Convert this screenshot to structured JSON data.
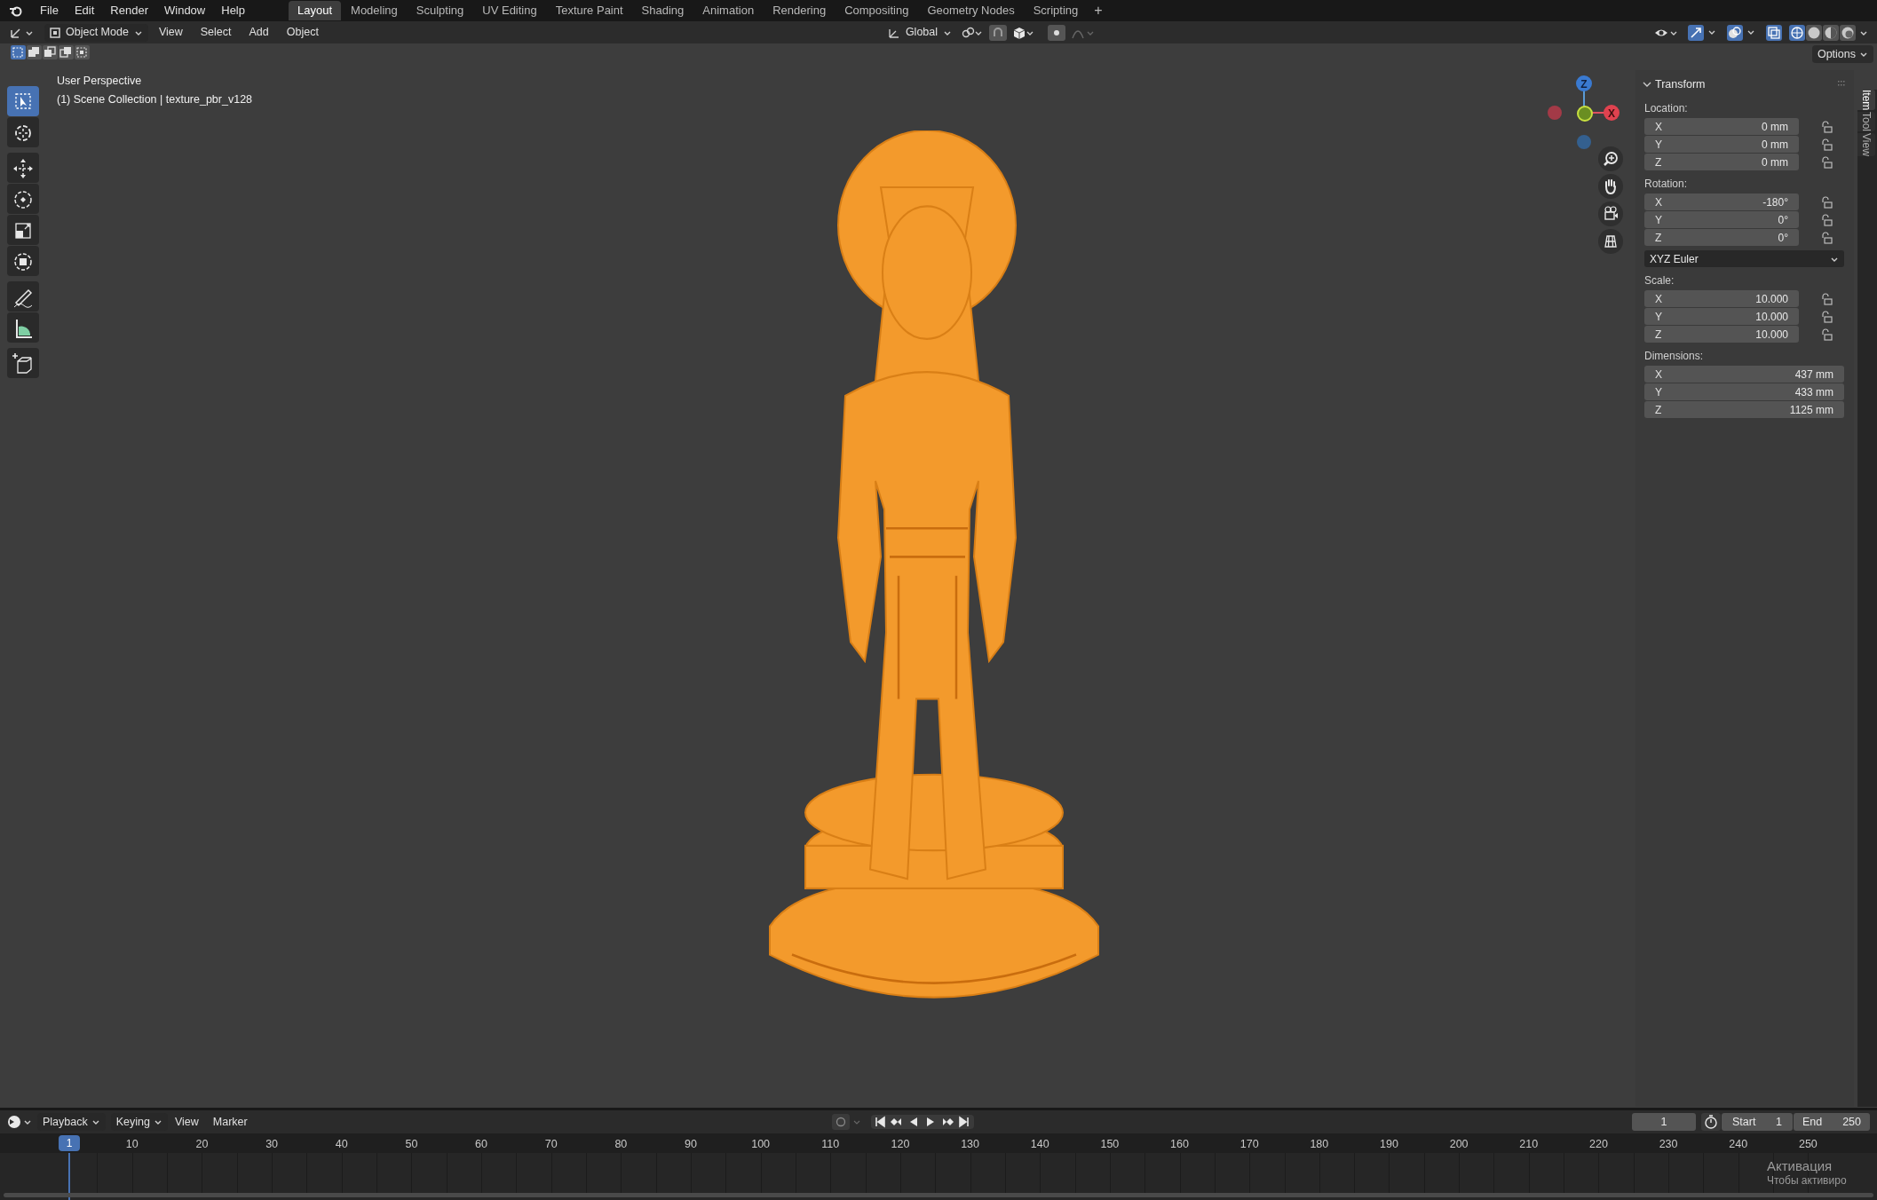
{
  "topbar": {
    "menus": [
      "File",
      "Edit",
      "Render",
      "Window",
      "Help"
    ],
    "workspaces": [
      {
        "label": "Layout",
        "selected": true
      },
      {
        "label": "Modeling",
        "selected": false
      },
      {
        "label": "Sculpting",
        "selected": false
      },
      {
        "label": "UV Editing",
        "selected": false
      },
      {
        "label": "Texture Paint",
        "selected": false
      },
      {
        "label": "Shading",
        "selected": false
      },
      {
        "label": "Animation",
        "selected": false
      },
      {
        "label": "Rendering",
        "selected": false
      },
      {
        "label": "Compositing",
        "selected": false
      },
      {
        "label": "Geometry Nodes",
        "selected": false
      },
      {
        "label": "Scripting",
        "selected": false
      }
    ],
    "add_tab": "+"
  },
  "viewport_header": {
    "mode": "Object Mode",
    "menus": [
      "View",
      "Select",
      "Add",
      "Object"
    ],
    "orientation": "Global",
    "shading_modes": [
      {
        "selected": true
      },
      {
        "selected": false
      },
      {
        "selected": false
      },
      {
        "selected": false
      }
    ]
  },
  "tool_settings": {
    "select_modes": [
      {
        "selected": true
      },
      {
        "selected": false
      },
      {
        "selected": false
      },
      {
        "selected": false
      },
      {
        "selected": false
      }
    ],
    "options": "Options"
  },
  "toolbar": {
    "groups": [
      {
        "tools": [
          {
            "kind": "select",
            "selected": true
          },
          {
            "kind": "cursor",
            "selected": false
          }
        ]
      },
      {
        "tools": [
          {
            "kind": "move",
            "selected": false
          },
          {
            "kind": "rotate",
            "selected": false
          },
          {
            "kind": "scale",
            "selected": false
          },
          {
            "kind": "transform",
            "selected": false
          }
        ]
      },
      {
        "tools": [
          {
            "kind": "annotate",
            "selected": false
          },
          {
            "kind": "measure",
            "selected": false
          }
        ]
      },
      {
        "tools": [
          {
            "kind": "add_cube",
            "selected": false
          }
        ]
      }
    ]
  },
  "viewport_info": [
    "User Perspective",
    "(1) Scene Collection | texture_pbr_v128"
  ],
  "gizmo": {
    "z_label": "Z",
    "x_label": "X"
  },
  "transform_panel": {
    "title": "Transform",
    "sections": [
      {
        "kind": "vector",
        "label": "Location:",
        "lockable": true,
        "fields": [
          {
            "axis": "X",
            "value": "0 mm"
          },
          {
            "axis": "Y",
            "value": "0 mm"
          },
          {
            "axis": "Z",
            "value": "0 mm"
          }
        ]
      },
      {
        "kind": "vector",
        "label": "Rotation:",
        "lockable": true,
        "fields": [
          {
            "axis": "X",
            "value": "-180°"
          },
          {
            "axis": "Y",
            "value": "0°"
          },
          {
            "axis": "Z",
            "value": "0°"
          }
        ]
      },
      {
        "kind": "dropdown",
        "value": "XYZ Euler"
      },
      {
        "kind": "vector",
        "label": "Scale:",
        "lockable": true,
        "fields": [
          {
            "axis": "X",
            "value": "10.000"
          },
          {
            "axis": "Y",
            "value": "10.000"
          },
          {
            "axis": "Z",
            "value": "10.000"
          }
        ]
      },
      {
        "kind": "vector",
        "label": "Dimensions:",
        "lockable": false,
        "fields": [
          {
            "axis": "X",
            "value": "437 mm"
          },
          {
            "axis": "Y",
            "value": "433 mm"
          },
          {
            "axis": "Z",
            "value": "1125 mm"
          }
        ]
      }
    ]
  },
  "sidebar_tabs": [
    {
      "label": "Item",
      "selected": true
    },
    {
      "label": "Tool",
      "selected": false
    },
    {
      "label": "View",
      "selected": false
    }
  ],
  "timeline": {
    "menus": [
      "Playback",
      "Keying",
      "View",
      "Marker"
    ],
    "current_frame": "1",
    "start_label": "Start",
    "start": "1",
    "end_label": "End",
    "end": "250",
    "playhead": "1",
    "ruler": [
      "10",
      "20",
      "30",
      "40",
      "50",
      "60",
      "70",
      "80",
      "90",
      "100",
      "110",
      "120",
      "130",
      "140",
      "150",
      "160",
      "170",
      "180",
      "190",
      "200",
      "210",
      "220",
      "230",
      "240",
      "250"
    ]
  },
  "activation_notice": {
    "title": "Активация",
    "subtitle": "Чтобы активиро"
  }
}
